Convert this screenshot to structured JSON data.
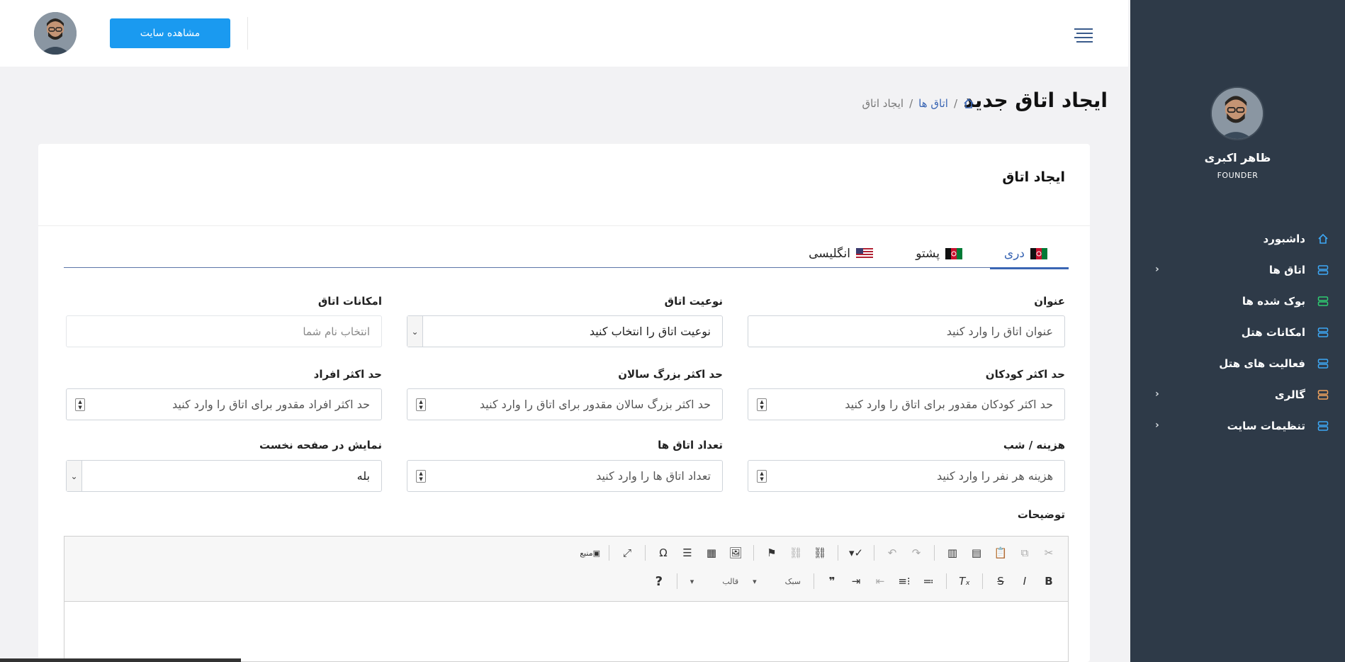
{
  "topbar": {
    "view_site_label": "مشاهده سایت"
  },
  "sidebar": {
    "user_name": "ظاهر اکبری",
    "user_role": "FOUNDER",
    "items": [
      {
        "label": "داشبورد",
        "icon": "home-icon",
        "color": "#3da8f5",
        "has_children": false
      },
      {
        "label": "اتاق ها",
        "icon": "server-icon",
        "color": "#3da8f5",
        "has_children": true
      },
      {
        "label": "بوک شده ها",
        "icon": "server-icon",
        "color": "#2ecc71",
        "has_children": false
      },
      {
        "label": "امکانات هتل",
        "icon": "server-icon",
        "color": "#3da8f5",
        "has_children": false
      },
      {
        "label": "فعالیت های هتل",
        "icon": "server-icon",
        "color": "#3da8f5",
        "has_children": false
      },
      {
        "label": "گالری",
        "icon": "server-icon",
        "color": "#f0a35e",
        "has_children": true
      },
      {
        "label": "تنظیمات سایت",
        "icon": "server-icon",
        "color": "#3da8f5",
        "has_children": true
      }
    ]
  },
  "page": {
    "title": "ایجاد اتاق جدید",
    "breadcrumb": {
      "section": "اتاق ها",
      "current": "ایجاد اتاق"
    }
  },
  "card": {
    "title": "ایجاد اتاق",
    "tabs": [
      {
        "label": "دری",
        "flag": "afghanistan-flag",
        "active": true
      },
      {
        "label": "پشتو",
        "flag": "afghanistan-flag",
        "active": false
      },
      {
        "label": "انگلیسی",
        "flag": "usa-flag",
        "active": false
      }
    ]
  },
  "form": {
    "title": {
      "label": "عنوان",
      "placeholder": "عنوان اتاق را وارد کنید"
    },
    "room_type": {
      "label": "نوعیت اتاق",
      "value": "نوعیت اتاق را انتخاب کنید"
    },
    "room_facilities": {
      "label": "امکانات اتاق",
      "placeholder": "انتخاب نام شما"
    },
    "max_children": {
      "label": "حد اکثر کودکان",
      "placeholder": "حد اکثر کودکان مقدور برای اتاق را وارد کنید"
    },
    "max_adults": {
      "label": "حد اکثر بزرگ سالان",
      "placeholder": "حد اکثر بزرگ سالان مقدور برای اتاق را وارد کنید"
    },
    "max_people": {
      "label": "حد اکثر افراد",
      "placeholder": "حد اکثر افراد مقدور برای اتاق را وارد کنید"
    },
    "cost_per_night": {
      "label": "هزینه / شب",
      "placeholder": "هزینه هر نفر را وارد کنید"
    },
    "room_count": {
      "label": "تعداد اتاق ها",
      "placeholder": "تعداد اتاق ها را وارد کنید"
    },
    "show_on_home": {
      "label": "نمایش در صفحه نخست",
      "value": "بله"
    },
    "description": {
      "label": "توضیحات"
    }
  },
  "editor": {
    "source_label": "منبع",
    "style_label": "سبک",
    "format_label": "قالب"
  },
  "colors": {
    "sidebar_bg": "#2e3a48",
    "primary_button": "#1a9af0",
    "accent_link": "#3a66b4"
  }
}
